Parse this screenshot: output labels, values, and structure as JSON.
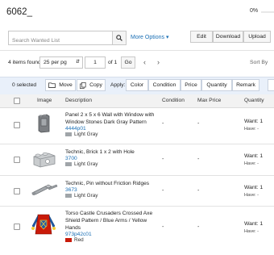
{
  "header": {
    "title": "6062_",
    "progress_text": "0%",
    "progress": 0
  },
  "search": {
    "placeholder": "Search Wanted List"
  },
  "toolbar": {
    "more_options": "More Options",
    "edit": "Edit",
    "download": "Download",
    "upload": "Upload"
  },
  "pager": {
    "count": "4 items found",
    "per_page": "25 per pg",
    "page": "1",
    "of_text": "of 1",
    "go": "Go",
    "sort_by": "Sort By"
  },
  "actions": {
    "selected": "0 selected",
    "move": "Move",
    "copy": "Copy",
    "apply": "Apply:",
    "color": "Color",
    "condition": "Condition",
    "price": "Price",
    "quantity": "Quantity",
    "remark": "Remark"
  },
  "columns": {
    "image": "Image",
    "description": "Description",
    "condition": "Condition",
    "max_price": "Max Price",
    "quantity": "Quantity"
  },
  "rows": [
    {
      "desc1": "Panel 2 x 5 x 6 Wall with Window with",
      "desc2": "Window Stones Dark Gray Pattern",
      "desc3": "",
      "id": "4444p01",
      "color": "Light Gray",
      "condition": "-",
      "price": "-",
      "want": "Want: 1",
      "have": "Have: -"
    },
    {
      "desc1": "Technic, Brick 1 x 2 with Hole",
      "desc2": "",
      "desc3": "",
      "id": "3700",
      "color": "Light Gray",
      "condition": "-",
      "price": "-",
      "want": "Want: 1",
      "have": "Have: -"
    },
    {
      "desc1": "Technic, Pin without Friction Ridges",
      "desc2": "",
      "desc3": "",
      "id": "3673",
      "color": "Light Gray",
      "condition": "-",
      "price": "-",
      "want": "Want: 1",
      "have": "Have: -"
    },
    {
      "desc1": "Torso Castle Crusaders Crossed Axe",
      "desc2": "Shield Pattern / Blue Arms / Yellow",
      "desc3": "Hands",
      "id": "973p42c01",
      "color": "Red",
      "condition": "-",
      "price": "-",
      "want": "Want: 1",
      "have": "Have: -"
    }
  ],
  "colors": {
    "accent": "#1a6fb5",
    "light_gray": "#a0a5a9",
    "red": "#c91a09",
    "action_bar": "#e9f0fa"
  }
}
